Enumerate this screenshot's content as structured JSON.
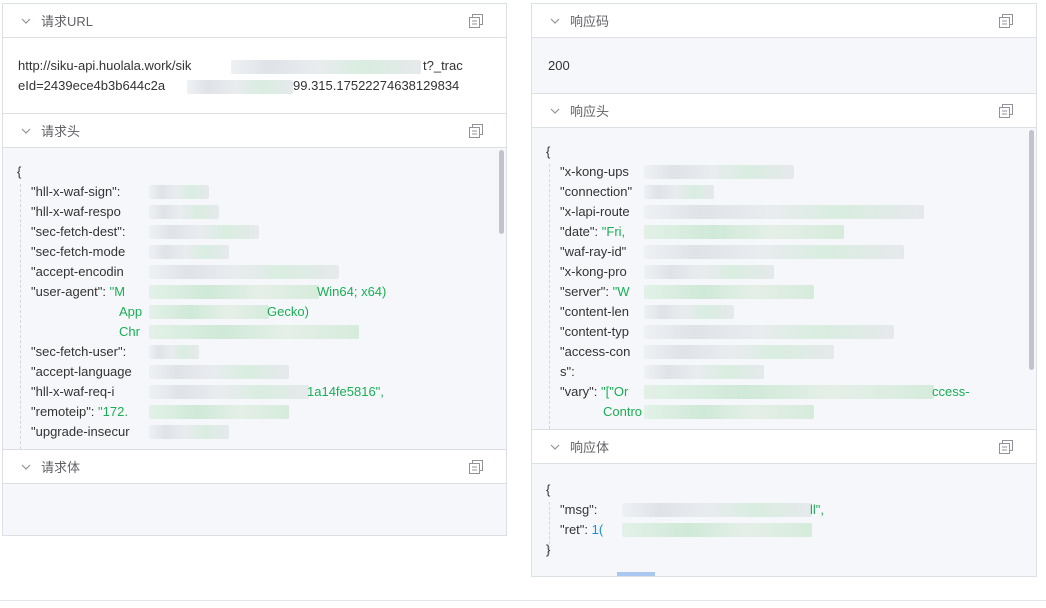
{
  "left": {
    "url_panel": {
      "title": "请求URL",
      "line1": "http://siku-api.huolala.work/sik",
      "line1_tail": "t?_trac",
      "line2": "eId=2439ece4b3b644c2a",
      "line2_tail": "99.315.17522274638129834"
    },
    "req_headers": {
      "title": "请求头",
      "open_brace": "{",
      "rows": [
        {
          "key": "\"hll-x-waf-sign\": ",
          "val": ""
        },
        {
          "key": "\"hll-x-waf-respo",
          "val": ""
        },
        {
          "key": "\"sec-fetch-dest\": ",
          "val": ""
        },
        {
          "key": "\"sec-fetch-mode",
          "val": ""
        },
        {
          "key": "\"accept-encodin",
          "val": ""
        },
        {
          "key": "\"user-agent\": ",
          "val": "\"M",
          "tail": "Win64; x64)"
        },
        {
          "key": "",
          "val": "App",
          "tail": "Gecko)",
          "indent": true
        },
        {
          "key": "",
          "val": "Chr",
          "indent": true
        },
        {
          "key": "\"sec-fetch-user\": ",
          "val": ""
        },
        {
          "key": "\"accept-language",
          "val": ""
        },
        {
          "key": "\"hll-x-waf-req-i",
          "val": "",
          "tail": "1a14fe5816\","
        },
        {
          "key": "\"remoteip\": ",
          "val": "\"172."
        },
        {
          "key": "\"upgrade-insecur",
          "val": ""
        }
      ]
    },
    "req_body": {
      "title": "请求体"
    }
  },
  "right": {
    "code_panel": {
      "title": "响应码",
      "value": "200"
    },
    "resp_headers": {
      "title": "响应头",
      "open_brace": "{",
      "rows": [
        {
          "key": "\"x-kong-ups",
          "val": ""
        },
        {
          "key": "\"connection\"",
          "val": ""
        },
        {
          "key": "\"x-lapi-route",
          "val": ""
        },
        {
          "key": "\"date\": ",
          "val": "\"Fri,"
        },
        {
          "key": "\"waf-ray-id\"",
          "val": ""
        },
        {
          "key": "\"x-kong-pro",
          "val": ""
        },
        {
          "key": "\"server\": ",
          "val": "\"W"
        },
        {
          "key": "\"content-len",
          "val": ""
        },
        {
          "key": "\"content-typ",
          "val": ""
        },
        {
          "key": "\"access-con",
          "val": ""
        },
        {
          "key": "s\":",
          "val": ""
        },
        {
          "key": "\"vary\": ",
          "val": "\"[\"Or",
          "tail": "ccess-"
        },
        {
          "key": "",
          "val": "Contro",
          "indent": true
        }
      ]
    },
    "resp_body": {
      "title": "响应体",
      "open_brace": "{",
      "close_brace": "}",
      "rows": [
        {
          "key": "\"msg\": ",
          "val": "",
          "tail": "ll\","
        },
        {
          "key": "\"ret\": ",
          "val": "1("
        }
      ]
    }
  },
  "icons": {
    "chevron": "chevron-down-icon",
    "copy": "copy-icon"
  },
  "colors": {
    "string": "#1aaf54",
    "number": "#1a8fd8",
    "border": "#dcdfe6",
    "panel_bg": "#f5f7fa"
  }
}
